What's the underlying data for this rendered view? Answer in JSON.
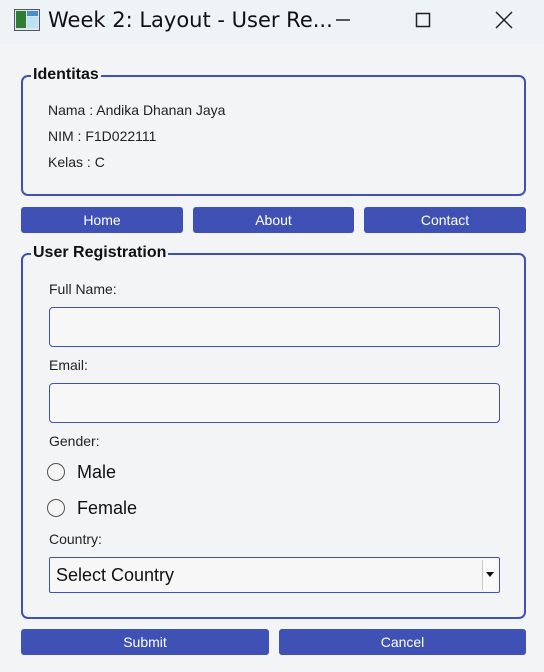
{
  "window": {
    "title": "Week 2: Layout - User Re...",
    "app_icon": "app-window-icon",
    "controls": [
      "minimize-icon",
      "maximize-icon",
      "close-icon"
    ]
  },
  "identitas": {
    "legend": "Identitas",
    "nama": "Nama : Andika Dhanan Jaya",
    "nim": "NIM : F1D022111",
    "kelas": "Kelas : C"
  },
  "nav": {
    "home": "Home",
    "about": "About",
    "contact": "Contact"
  },
  "registration": {
    "legend": "User Registration",
    "full_name_label": "Full Name:",
    "full_name_value": "",
    "email_label": "Email:",
    "email_value": "",
    "gender_label": "Gender:",
    "gender_options": [
      "Male",
      "Female"
    ],
    "country_label": "Country:",
    "country_selected": "Select Country"
  },
  "actions": {
    "submit": "Submit",
    "cancel": "Cancel"
  },
  "colors": {
    "accent": "#3f51b5",
    "background": "#f3f4f6",
    "titlebar": "#eef3f6"
  }
}
